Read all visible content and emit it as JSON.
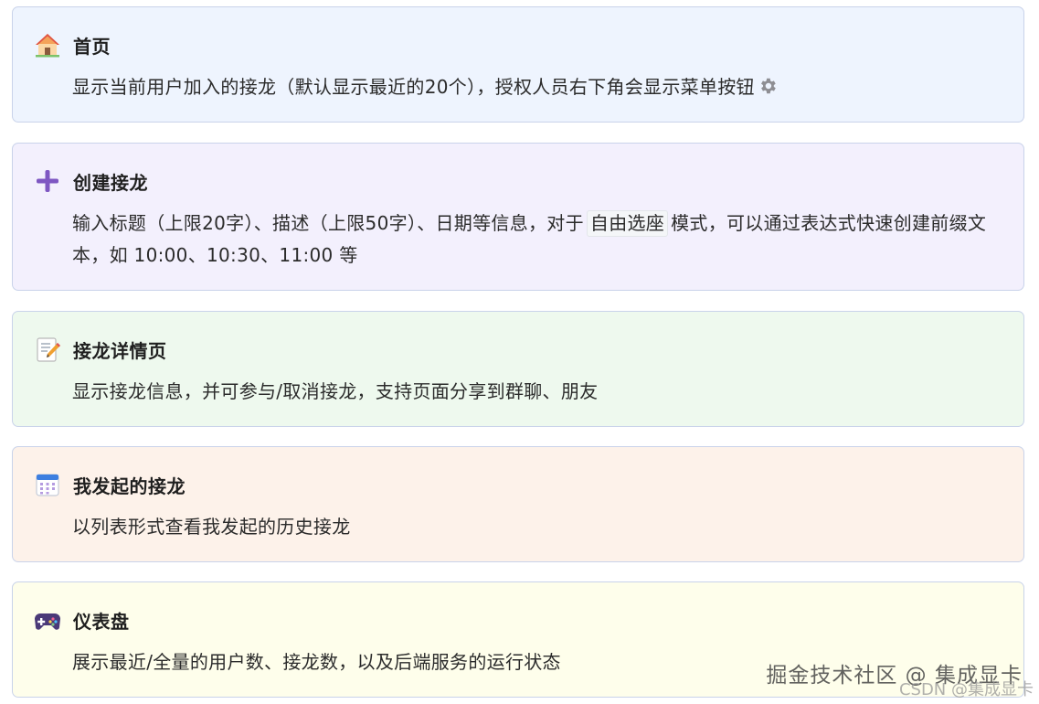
{
  "cards": [
    {
      "icon": "house-icon",
      "title": "首页",
      "description": "显示当前用户加入的接龙（默认显示最近的20个），授权人员右下角会显示菜单按钮",
      "inline_icon": "gear-icon",
      "background": "#eef4fe"
    },
    {
      "icon": "plus-icon",
      "title": "创建接龙",
      "description_before": "输入标题（上限20字）、描述（上限50字）、日期等信息，对于",
      "description_code": "自由选座",
      "description_after": "模式，可以通过表达式快速创建前缀文本，如 10:00、10:30、11:00 等",
      "background": "#f3f0fd"
    },
    {
      "icon": "memo-icon",
      "title": "接龙详情页",
      "description": "显示接龙信息，并可参与/取消接龙，支持页面分享到群聊、朋友",
      "background": "#eef9ee"
    },
    {
      "icon": "calendar-icon",
      "title": "我发起的接龙",
      "description": "以列表形式查看我发起的历史接龙",
      "background": "#fdf2ea"
    },
    {
      "icon": "gamepad-icon",
      "title": "仪表盘",
      "description": "展示最近/全量的用户数、接龙数，以及后端服务的运行状态",
      "background": "#fefeeb"
    }
  ],
  "watermark": {
    "line1": "掘金技术社区 @ 集成显卡",
    "line2": "CSDN @集成显卡"
  },
  "colors": {
    "border": "#c9d3ea",
    "plus_icon": "#7e57c2"
  }
}
